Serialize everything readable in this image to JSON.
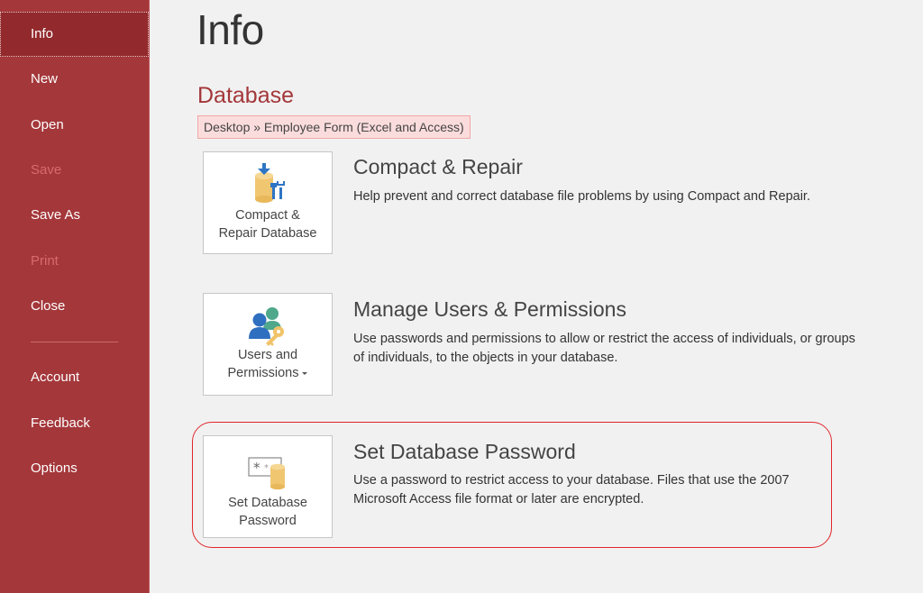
{
  "sidebar": {
    "items": [
      {
        "label": "Info",
        "state": "active"
      },
      {
        "label": "New",
        "state": "enabled"
      },
      {
        "label": "Open",
        "state": "enabled"
      },
      {
        "label": "Save",
        "state": "disabled"
      },
      {
        "label": "Save As",
        "state": "enabled"
      },
      {
        "label": "Print",
        "state": "disabled"
      },
      {
        "label": "Close",
        "state": "enabled"
      },
      {
        "label": "Account",
        "state": "enabled"
      },
      {
        "label": "Feedback",
        "state": "enabled"
      },
      {
        "label": "Options",
        "state": "enabled"
      }
    ]
  },
  "main": {
    "page_title": "Info",
    "section_title": "Database",
    "breadcrumb": "Desktop » Employee Form (Excel and Access)",
    "actions": [
      {
        "tile_line1": "Compact &",
        "tile_line2": "Repair Database",
        "icon": "compact-repair-icon",
        "heading": "Compact & Repair",
        "description": "Help prevent and correct database file problems by using Compact and Repair."
      },
      {
        "tile_line1": "Users and",
        "tile_line2": "Permissions",
        "icon": "users-permissions-icon",
        "has_dropdown": true,
        "heading": "Manage Users & Permissions",
        "description": "Use passwords and permissions to allow or restrict the access of individuals, or groups of individuals, to the objects in your database."
      },
      {
        "tile_line1": "Set Database",
        "tile_line2": "Password",
        "icon": "database-password-icon",
        "highlighted": true,
        "heading": "Set Database Password",
        "description": "Use a password to restrict access to your database. Files that use the 2007 Microsoft Access file format or later are encrypted."
      }
    ]
  },
  "colors": {
    "accent": "#a4373a",
    "sidebar_active": "#922a2d",
    "highlight": "#e0262a",
    "background": "#f1f1f1"
  }
}
